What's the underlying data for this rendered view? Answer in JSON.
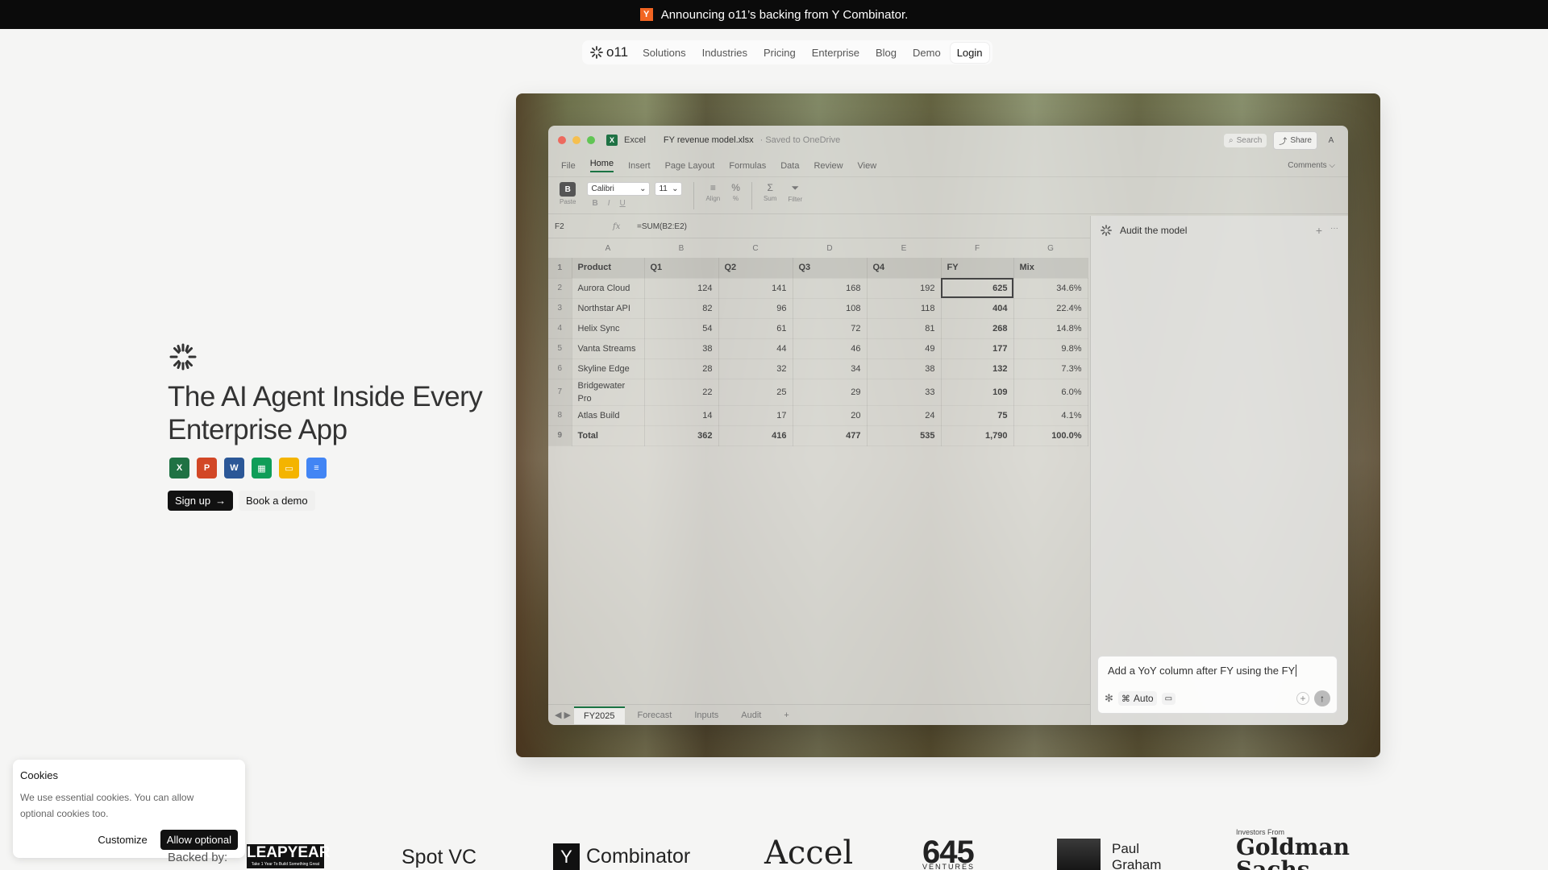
{
  "announcement": {
    "badge": "Y",
    "text": "Announcing o11’s backing from Y Combinator."
  },
  "nav": {
    "brand": "o11",
    "items": [
      "Solutions",
      "Industries",
      "Pricing",
      "Enterprise",
      "Blog",
      "Demo"
    ],
    "login": "Login"
  },
  "hero": {
    "title": "The AI Agent Inside Every Enterprise App",
    "app_icons": [
      {
        "name": "excel-icon",
        "letter": "X",
        "color": "#1f7244"
      },
      {
        "name": "powerpoint-icon",
        "letter": "P",
        "color": "#d24726"
      },
      {
        "name": "word-icon",
        "letter": "W",
        "color": "#2b5797"
      },
      {
        "name": "google-sheets-icon",
        "letter": "▦",
        "color": "#0f9d58"
      },
      {
        "name": "google-slides-icon",
        "letter": "▭",
        "color": "#f4b400"
      },
      {
        "name": "google-docs-icon",
        "letter": "≡",
        "color": "#4285f4"
      }
    ],
    "signup": "Sign up",
    "signup_arrow": "→",
    "book_demo": "Book a demo"
  },
  "excel": {
    "app": "Excel",
    "file": "FY revenue model.xlsx",
    "saved": "· Saved to OneDrive",
    "search": "Search",
    "share": "Share",
    "avatar": "A",
    "tabs": [
      "File",
      "Home",
      "Insert",
      "Page Layout",
      "Formulas",
      "Data",
      "Review",
      "View"
    ],
    "active_tab": "Home",
    "comments": "Comments ⌵",
    "ribbon": {
      "paste_b": "B",
      "paste": "Paste",
      "font": "Calibri",
      "size": "11",
      "bold": "B",
      "italic": "I",
      "underline": "U",
      "align": "Align",
      "percent": "%",
      "sum": "Sum",
      "filter": "Filter"
    },
    "cell_ref": "F2",
    "fx": "fx",
    "formula": "=SUM(B2:E2)",
    "columns": [
      "A",
      "B",
      "C",
      "D",
      "E",
      "F",
      "G"
    ],
    "header": [
      "Product",
      "Q1",
      "Q2",
      "Q3",
      "Q4",
      "FY",
      "Mix"
    ],
    "rows": [
      {
        "n": "2",
        "cells": [
          "Aurora Cloud",
          "124",
          "141",
          "168",
          "192",
          "625",
          "34.6%"
        ]
      },
      {
        "n": "3",
        "cells": [
          "Northstar API",
          "82",
          "96",
          "108",
          "118",
          "404",
          "22.4%"
        ]
      },
      {
        "n": "4",
        "cells": [
          "Helix Sync",
          "54",
          "61",
          "72",
          "81",
          "268",
          "14.8%"
        ]
      },
      {
        "n": "5",
        "cells": [
          "Vanta Streams",
          "38",
          "44",
          "46",
          "49",
          "177",
          "9.8%"
        ]
      },
      {
        "n": "6",
        "cells": [
          "Skyline Edge",
          "28",
          "32",
          "34",
          "38",
          "132",
          "7.3%"
        ]
      },
      {
        "n": "7",
        "cells": [
          "Bridgewater Pro",
          "22",
          "25",
          "29",
          "33",
          "109",
          "6.0%"
        ]
      },
      {
        "n": "8",
        "cells": [
          "Atlas Build",
          "14",
          "17",
          "20",
          "24",
          "75",
          "4.1%"
        ]
      },
      {
        "n": "9",
        "cells": [
          "Total",
          "362",
          "416",
          "477",
          "535",
          "1,790",
          "100.0%"
        ],
        "total": true
      }
    ],
    "sheet_tabs": [
      "FY2025",
      "Forecast",
      "Inputs",
      "Audit"
    ],
    "active_sheet": "FY2025",
    "nav_arrows": "◀ ▶",
    "add_sheet": "+"
  },
  "agent_panel": {
    "title": "Audit the model",
    "add": "+",
    "more": "···",
    "input_text": "Add a YoY column after FY using the FY",
    "mode": "Auto",
    "attach": "+",
    "send": "↑"
  },
  "cookie": {
    "title": "Cookies",
    "text": "We use essential cookies. You can allow optional cookies too.",
    "customize": "Customize",
    "allow": "Allow optional"
  },
  "backers": {
    "label": "Backed by:",
    "leapyear": "LEAPYEAR",
    "leapyear_tag": "Take 1 Year To Build Something Great",
    "spot": "Spot VC",
    "yc_letter": "Y",
    "yc": "Combinator",
    "accel": "Accel",
    "v645": "645",
    "v645_sub": "VENTURES",
    "pg": "Paul Graham",
    "gs_caption": "Investors From",
    "gs": "Goldman Sachs"
  }
}
